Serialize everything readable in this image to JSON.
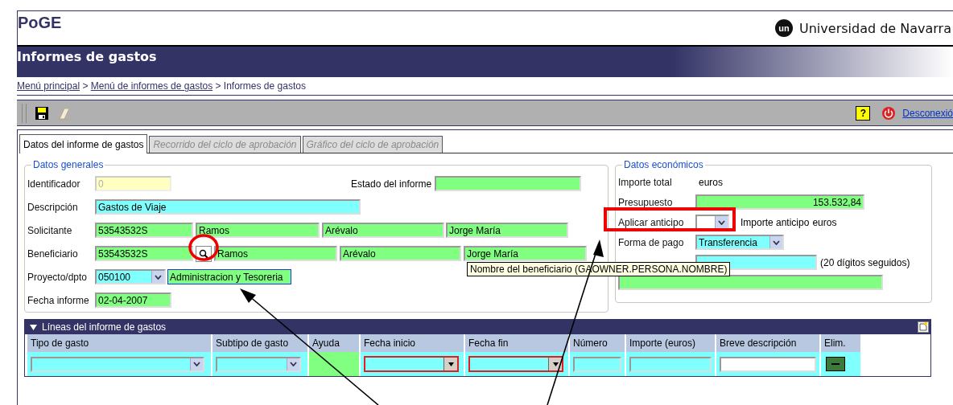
{
  "header": {
    "app_name": "PoGE",
    "logo_text": "un",
    "institution": "Universidad de Navarra"
  },
  "title_bar": {
    "title": "Informes de gastos"
  },
  "breadcrumb": [
    {
      "label": "Menú principal",
      "kind": "link"
    },
    {
      "label": " > ",
      "kind": "text"
    },
    {
      "label": "Menú de informes de gastos",
      "kind": "link"
    },
    {
      "label": " > Informes de gastos",
      "kind": "text"
    }
  ],
  "toolbar": {
    "help": "?",
    "logout": "Desconexió"
  },
  "tabs": [
    {
      "label": "Datos del informe de gastos",
      "selected": true,
      "disabled": false
    },
    {
      "label": "Recorrido del ciclo de aprobación",
      "selected": false,
      "disabled": true
    },
    {
      "label": "Gráfico del ciclo de aprobación",
      "selected": false,
      "disabled": true
    }
  ],
  "general": {
    "legend": "Datos generales",
    "rows": [
      {
        "label": "Identificador",
        "items": [
          {
            "kind": "field",
            "value": "0",
            "color": "#ffffc0",
            "disabled": true
          },
          {
            "kind": "label",
            "text": "Estado del informe"
          },
          {
            "kind": "field",
            "value": "",
            "color": "#80ff80",
            "disabled": false
          }
        ]
      },
      {
        "label": "Descripción",
        "items": [
          {
            "kind": "field",
            "value": "Gastos de Viaje",
            "color": "#80ffff",
            "disabled": false
          }
        ]
      },
      {
        "label": "Solicitante",
        "items": [
          {
            "kind": "field",
            "value": "53543532S",
            "color": "#80ff80",
            "disabled": false
          },
          {
            "kind": "field",
            "value": "Ramos",
            "color": "#80ff80",
            "disabled": false
          },
          {
            "kind": "field",
            "value": "Arévalo",
            "color": "#80ff80",
            "disabled": false
          },
          {
            "kind": "field",
            "value": "Jorge María",
            "color": "#80ff80",
            "disabled": false
          }
        ]
      },
      {
        "label": "Beneficiario",
        "items": [
          {
            "kind": "field",
            "value": "53543532S",
            "color": "#80ff80",
            "disabled": false
          },
          {
            "kind": "search"
          },
          {
            "kind": "field",
            "value": "Ramos",
            "color": "#80ff80",
            "disabled": false
          },
          {
            "kind": "field",
            "value": "Arévalo",
            "color": "#80ff80",
            "disabled": false
          },
          {
            "kind": "field",
            "value": "Jorge María",
            "color": "#80ff80",
            "disabled": false
          }
        ]
      },
      {
        "label": "Proyecto/dpto",
        "items": [
          {
            "kind": "select",
            "value": "050100",
            "color": "#80ffff"
          },
          {
            "kind": "focused",
            "value": "Administracion y Tesoreria",
            "color": "#80ff80"
          }
        ]
      },
      {
        "label": "Fecha informe",
        "items": [
          {
            "kind": "field",
            "value": "02-04-2007",
            "color": "#80ff80",
            "disabled": false
          }
        ]
      }
    ]
  },
  "economic": {
    "legend": "Datos económicos",
    "rows": [
      {
        "label": "Importe total",
        "items": [
          {
            "kind": "label",
            "text": "euros"
          }
        ]
      },
      {
        "label": "Presupuesto",
        "items": [
          {
            "kind": "amount",
            "value": "153.532,84",
            "color": "#80ff80"
          }
        ]
      },
      {
        "label": "Aplicar anticipo",
        "items": [
          {
            "kind": "select",
            "value": ""
          },
          {
            "kind": "label",
            "text": "Importe anticipo"
          },
          {
            "kind": "label",
            "text": "euros"
          }
        ]
      },
      {
        "label": "Forma de pago",
        "items": [
          {
            "kind": "select",
            "value": "Transferencia",
            "color": "#80ffff"
          }
        ]
      },
      {
        "label": "",
        "items": [
          {
            "kind": "field",
            "value": "",
            "color": "#80ffff",
            "disabled": false
          },
          {
            "kind": "label",
            "text": "(20 dígitos seguidos)"
          }
        ]
      },
      {
        "label": "",
        "items": [
          {
            "kind": "wide",
            "value": "",
            "color": "#80ff80"
          }
        ]
      }
    ]
  },
  "lines": {
    "title": "Líneas del informe de gastos",
    "columns": [
      "Tipo de gasto",
      "Subtipo de gasto",
      "Ayuda",
      "Fecha inicio",
      "Fecha fin",
      "Número",
      "Importe (euros)",
      "Breve descripción",
      "Elim."
    ],
    "row": [
      {
        "kind": "select",
        "color": "#80ffff"
      },
      {
        "kind": "select",
        "color": "#80ffff"
      },
      {
        "kind": "blank",
        "color": "#80ff80"
      },
      {
        "kind": "date",
        "color": "#80ffff"
      },
      {
        "kind": "date",
        "color": "#80ffff"
      },
      {
        "kind": "field",
        "color": "#80ffff"
      },
      {
        "kind": "field",
        "color": "#80ffff"
      },
      {
        "kind": "field",
        "color": "#ffffff"
      },
      {
        "kind": "delete",
        "color": "#80ffff"
      }
    ]
  },
  "tooltip": "Nombre del beneficiario (GAOWNER.PERSONA.NOMBRE)"
}
